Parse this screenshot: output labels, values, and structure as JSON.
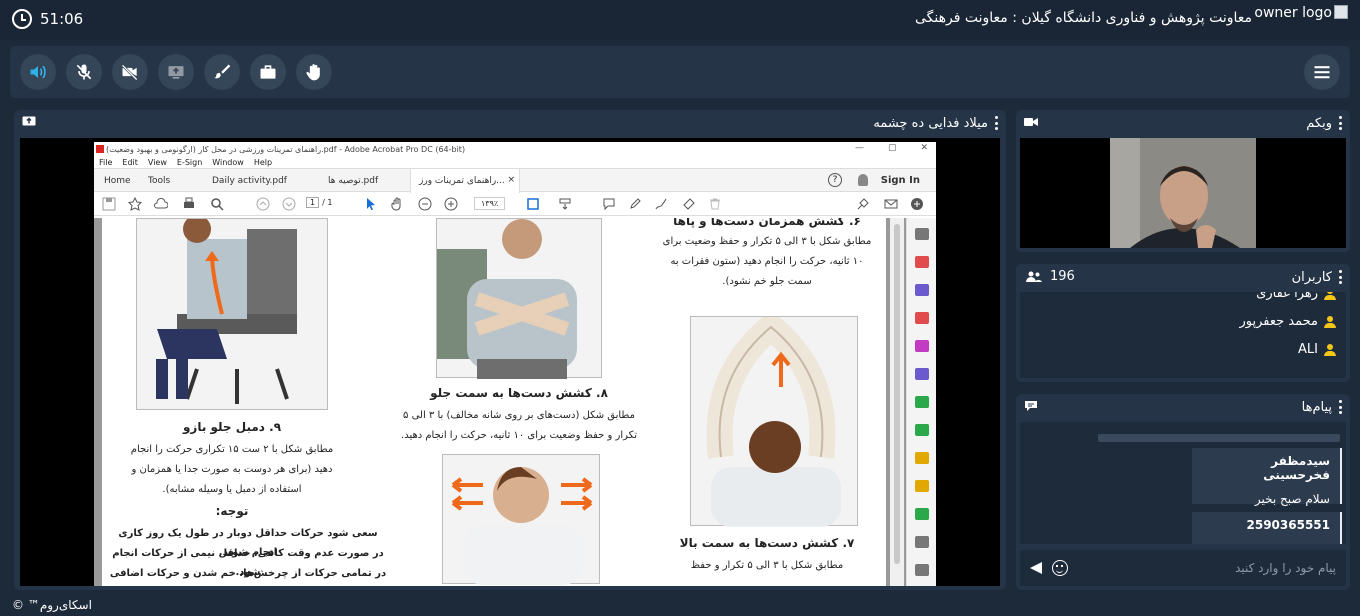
{
  "header": {
    "timer": "51:06",
    "org_title": "معاونت پژوهش و فناوری دانشگاه گیلان : معاونت فرهنگی",
    "owner_logo_alt": "owner logo"
  },
  "colors": {
    "accent": "#2fb0e6",
    "bg": "#1d2a3a",
    "panel": "#253447",
    "user_icon": "#f5c518"
  },
  "toolbar": {
    "buttons": [
      "speaker-icon",
      "mic-off-icon",
      "camera-off-icon",
      "screen-share-icon",
      "brush-icon",
      "briefcase-icon",
      "raise-hand-icon"
    ],
    "menu": "hamburger-icon"
  },
  "share": {
    "presenter": "میلاد فدایی ده چشمه",
    "acrobat": {
      "title": "راهنمای تمرینات ورزشی در محل کار (ارگونومی و بهبود وضعیت).pdf - Adobe Acrobat Pro DC (64-bit)",
      "menu": [
        "File",
        "Edit",
        "View",
        "E-Sign",
        "Window",
        "Help"
      ],
      "tabs": [
        "Home",
        "Tools",
        "Daily activity.pdf",
        "توصیه ها.pdf",
        "راهنمای تمرینات ورز..."
      ],
      "sign_in": "Sign In",
      "page_current": "1",
      "page_total": "/ 1",
      "zoom": "۱۳۹٪"
    },
    "doc": {
      "ex6_title": "۶. کشش همزمان دست‌ها و پاها",
      "ex6_body": [
        "مطابق شکل با ۳ الی ۵ تکرار و حفظ وضعیت برای",
        "۱۰ ثانیه، حرکت را انجام دهید (ستون فقرات به",
        "سمت جلو خم نشود)."
      ],
      "ex7_title": "۷. کشش دست‌ها به سمت بالا",
      "ex7_body": [
        "مطابق شکل با ۳ الی ۵ تکرار و حفظ"
      ],
      "ex8_title": "۸. کشش دست‌ها به سمت جلو",
      "ex8_body": [
        "مطابق شکل (دست‌های بر روی شانه مخالف) با ۳ الی ۵",
        "تکرار و حفظ وضعیت برای ۱۰ ثانیه، حرکت را انجام دهید."
      ],
      "ex9_title": "۹. دمبل جلو بازو",
      "ex9_body": [
        "مطابق شکل با ۲ ست ۱۵ تکراری حرکت را انجام",
        "دهید (برای هر دوست به صورت جدا یا همزمان و",
        "استفاده از دمبل یا وسیله مشابه)."
      ],
      "note_title": "توجه:",
      "note_body": [
        "سعی شود حرکات حداقل دوبار در طول یک روز کاری انجام شوند.",
        "در صورت عدم وقت کافی، حداقل نیمی از حرکات انجام شود.",
        "در تمامی حرکات از چرخش‌ها، خم شدن و حرکات اضافی ستون"
      ]
    }
  },
  "webcam": {
    "title": "وبکم"
  },
  "users": {
    "title": "کاربران",
    "count": "196",
    "list": [
      "زهرا غفاری",
      "محمد جعفرپور",
      "ALI"
    ]
  },
  "messages": {
    "title": "پیام‌ها",
    "items": [
      {
        "sender": "سیدمظفر فخرحسینی",
        "body": "سلام صبح بخیر"
      },
      {
        "sender": "2590365551",
        "body": ""
      }
    ],
    "placeholder": "پیام خود را وارد کنید"
  },
  "footer": {
    "brand": "اسکای‌روم™ ©"
  }
}
